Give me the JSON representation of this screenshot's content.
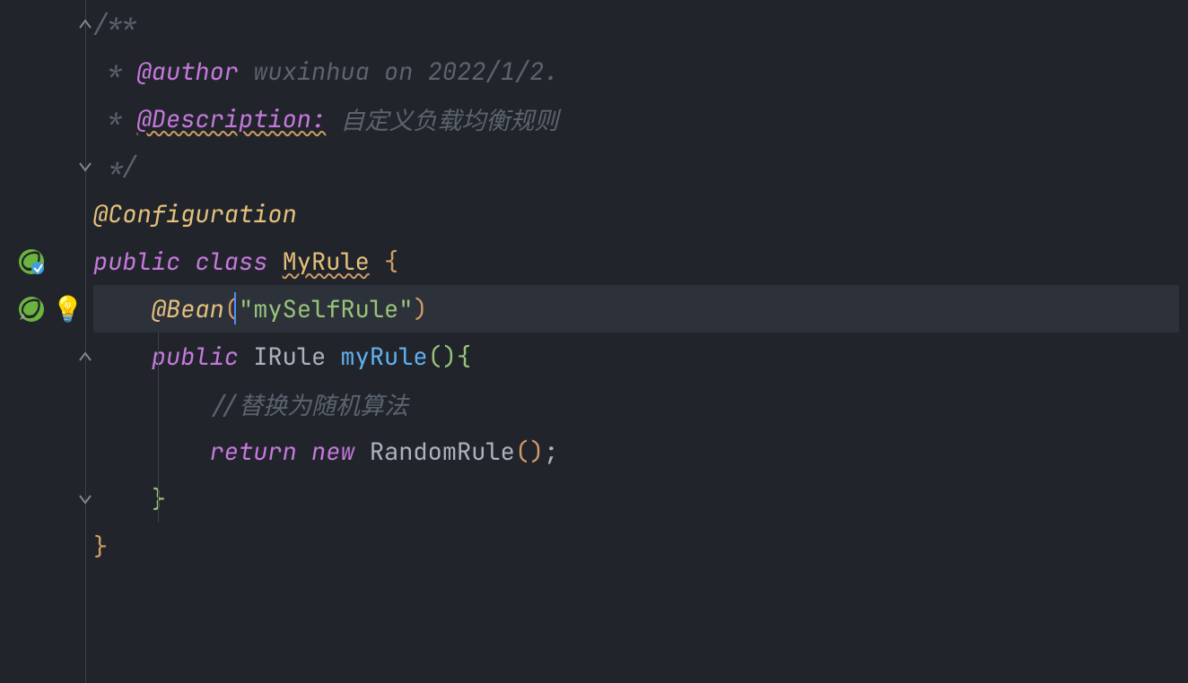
{
  "code": {
    "doc_open": "/**",
    "doc_author_star": " * ",
    "doc_author_tag": "@author",
    "doc_author_text": " wuxinhua on 2022/1/2.",
    "doc_desc_star": " * ",
    "doc_desc_tag": "@Description:",
    "doc_desc_text": " 自定义负载均衡规则",
    "doc_close": " */",
    "annotation_config": "@Configuration",
    "kw_public": "public",
    "kw_class": "class",
    "class_name": "MyRule",
    "brace_open": " {",
    "annotation_bean": "@Bean",
    "bean_paren_open": "(",
    "bean_string": "\"mySelfRule\"",
    "bean_paren_close": ")",
    "kw_public2": "public",
    "type_irule": "IRule",
    "method_name": "myRule",
    "method_parens": "()",
    "method_brace": "{",
    "inline_comment": "//替换为随机算法",
    "kw_return": "return",
    "kw_new": "new",
    "ctor_name": "RandomRule",
    "ctor_parens": "()",
    "semicolon": ";",
    "brace_close_inner": "}",
    "brace_close_outer": "}"
  },
  "gutter": {
    "bulb_icon": "💡"
  }
}
